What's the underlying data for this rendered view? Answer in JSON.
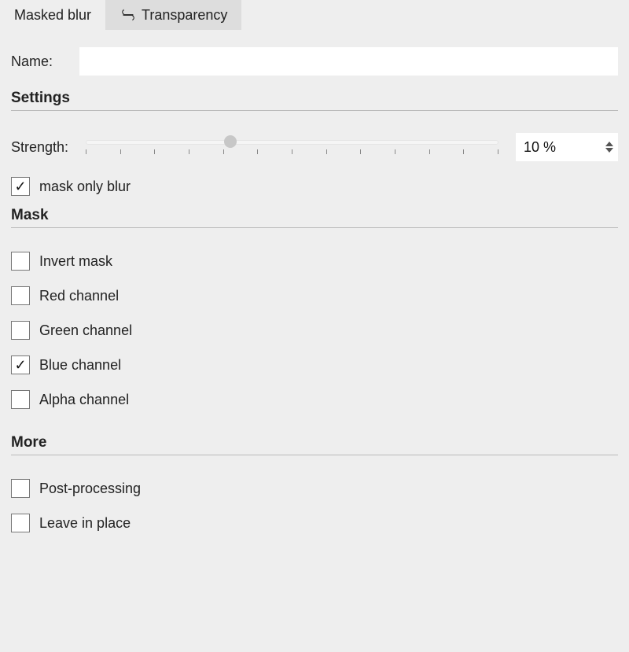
{
  "tabs": {
    "masked_blur": "Masked blur",
    "transparency": "Transparency"
  },
  "name": {
    "label": "Name:",
    "value": ""
  },
  "sections": {
    "settings": "Settings",
    "mask": "Mask",
    "more": "More"
  },
  "strength": {
    "label": "Strength:",
    "value": "10 %"
  },
  "checkboxes": {
    "mask_only_blur": {
      "label": "mask only blur",
      "checked": true
    },
    "invert_mask": {
      "label": "Invert mask",
      "checked": false
    },
    "red_channel": {
      "label": "Red channel",
      "checked": false
    },
    "green_channel": {
      "label": "Green channel",
      "checked": false
    },
    "blue_channel": {
      "label": "Blue channel",
      "checked": true
    },
    "alpha_channel": {
      "label": "Alpha channel",
      "checked": false
    },
    "post_processing": {
      "label": "Post-processing",
      "checked": false
    },
    "leave_in_place": {
      "label": "Leave in place",
      "checked": false
    }
  }
}
